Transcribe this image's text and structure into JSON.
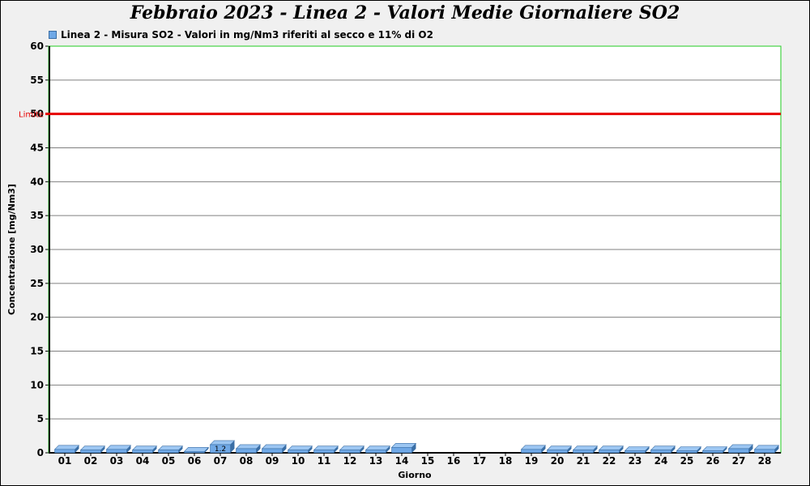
{
  "chart_data": {
    "type": "bar",
    "title": "Febbraio 2023 - Linea 2 - Valori Medie Giornaliere SO2",
    "legend": "Linea 2 - Misura SO2 - Valori in mg/Nm3 riferiti al secco e 11% di O2",
    "xlabel": "Giorno",
    "ylabel": "Concentrazione [mg/Nm3]",
    "ylim": [
      0,
      60
    ],
    "yticks": [
      0,
      5,
      10,
      15,
      20,
      25,
      30,
      35,
      40,
      45,
      50,
      55,
      60
    ],
    "grid": true,
    "categories": [
      "01",
      "02",
      "03",
      "04",
      "05",
      "06",
      "07",
      "08",
      "09",
      "10",
      "11",
      "12",
      "13",
      "14",
      "15",
      "16",
      "17",
      "18",
      "19",
      "20",
      "21",
      "22",
      "23",
      "24",
      "25",
      "26",
      "27",
      "28"
    ],
    "values": [
      0.5,
      0.4,
      0.5,
      0.4,
      0.4,
      0.2,
      1.2,
      0.6,
      0.6,
      0.4,
      0.4,
      0.4,
      0.4,
      0.8,
      0.0,
      0.0,
      0.0,
      0.0,
      0.5,
      0.4,
      0.4,
      0.4,
      0.3,
      0.4,
      0.3,
      0.3,
      0.6,
      0.5
    ],
    "data_labels": [
      {
        "index": 6,
        "text": "1.2"
      }
    ],
    "limit": {
      "label": "Limite",
      "value": 50
    },
    "colors": {
      "bar": "#6fa8e6",
      "bar_top": "#9cc6f2",
      "bar_edge": "#3a6ea5",
      "limit": "#e60000",
      "plot_border": "#22cc22",
      "grid": "#808080",
      "plot_bg": "#ffffff"
    }
  }
}
